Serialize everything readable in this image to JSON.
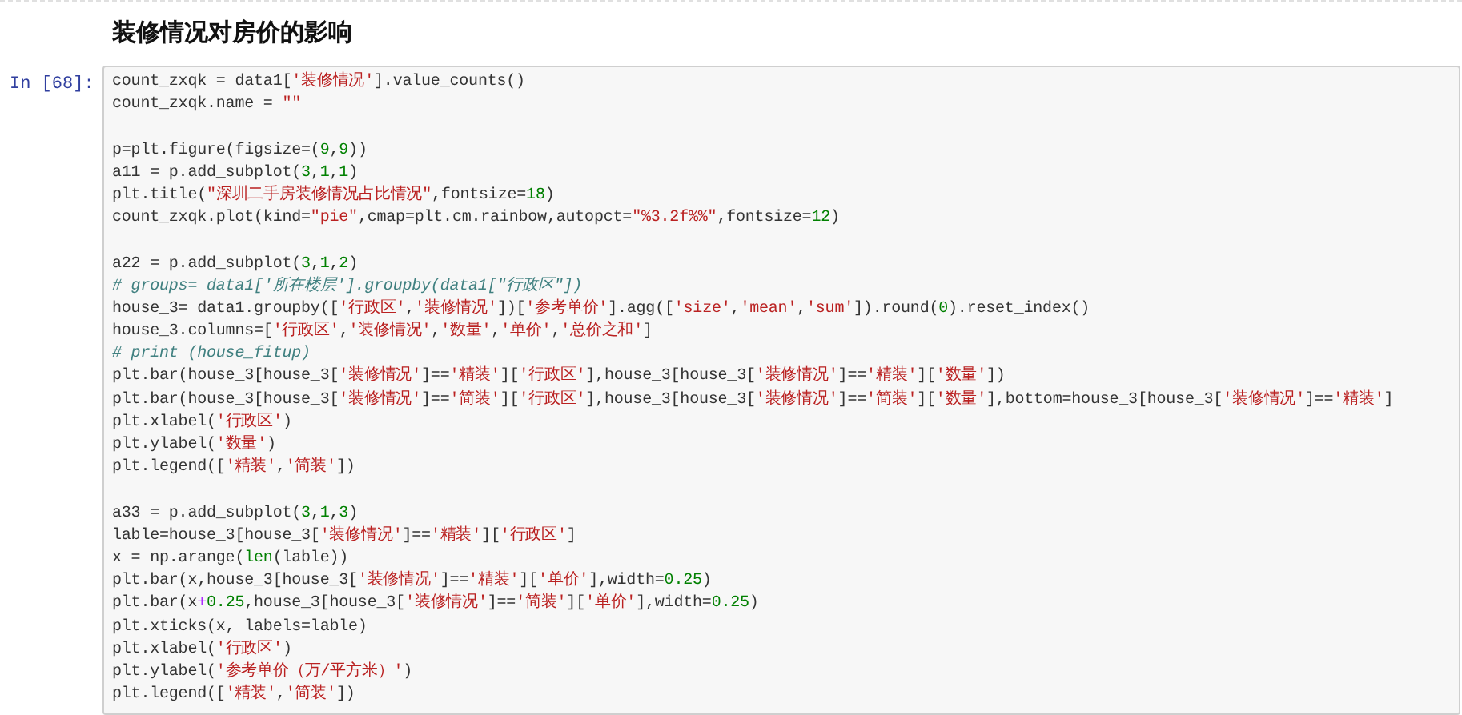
{
  "heading": "装修情况对房价的影响",
  "cell": {
    "prompt": "In [68]:",
    "blocks": [
      [
        [
          {
            "kind": "code",
            "text": "count_zxqk = data1["
          },
          {
            "kind": "string",
            "text": "'装修情况'"
          },
          {
            "kind": "code",
            "text": "].value_counts()"
          }
        ],
        [
          {
            "kind": "code",
            "text": "count_zxqk.name = "
          },
          {
            "kind": "string",
            "text": "\"\""
          }
        ]
      ],
      [
        [
          {
            "kind": "code",
            "text": "p=plt.figure(figsize=("
          },
          {
            "kind": "number",
            "text": "9"
          },
          {
            "kind": "code",
            "text": ","
          },
          {
            "kind": "number",
            "text": "9"
          },
          {
            "kind": "code",
            "text": "))"
          }
        ],
        [
          {
            "kind": "code",
            "text": "a11 = p.add_subplot("
          },
          {
            "kind": "number",
            "text": "3"
          },
          {
            "kind": "code",
            "text": ","
          },
          {
            "kind": "number",
            "text": "1"
          },
          {
            "kind": "code",
            "text": ","
          },
          {
            "kind": "number",
            "text": "1"
          },
          {
            "kind": "code",
            "text": ")"
          }
        ],
        [
          {
            "kind": "code",
            "text": "plt.title("
          },
          {
            "kind": "string",
            "text": "\"深圳二手房装修情况占比情况\""
          },
          {
            "kind": "code",
            "text": ",fontsize="
          },
          {
            "kind": "number",
            "text": "18"
          },
          {
            "kind": "code",
            "text": ")"
          }
        ],
        [
          {
            "kind": "code",
            "text": "count_zxqk.plot(kind="
          },
          {
            "kind": "string",
            "text": "\"pie\""
          },
          {
            "kind": "code",
            "text": ",cmap=plt.cm.rainbow,autopct="
          },
          {
            "kind": "string",
            "text": "\"%3.2f%%\""
          },
          {
            "kind": "code",
            "text": ",fontsize="
          },
          {
            "kind": "number",
            "text": "12"
          },
          {
            "kind": "code",
            "text": ")"
          }
        ]
      ],
      [
        [
          {
            "kind": "code",
            "text": "a22 = p.add_subplot("
          },
          {
            "kind": "number",
            "text": "3"
          },
          {
            "kind": "code",
            "text": ","
          },
          {
            "kind": "number",
            "text": "1"
          },
          {
            "kind": "code",
            "text": ","
          },
          {
            "kind": "number",
            "text": "2"
          },
          {
            "kind": "code",
            "text": ")"
          }
        ],
        [
          {
            "kind": "comment",
            "text": "# groups= data1['所在楼层'].groupby(data1[\"行政区\"])"
          }
        ],
        [
          {
            "kind": "code",
            "text": "house_3= data1.groupby(["
          },
          {
            "kind": "string",
            "text": "'行政区'"
          },
          {
            "kind": "code",
            "text": ","
          },
          {
            "kind": "string",
            "text": "'装修情况'"
          },
          {
            "kind": "code",
            "text": "])["
          },
          {
            "kind": "string",
            "text": "'参考单价'"
          },
          {
            "kind": "code",
            "text": "].agg(["
          },
          {
            "kind": "string",
            "text": "'size'"
          },
          {
            "kind": "code",
            "text": ","
          },
          {
            "kind": "string",
            "text": "'mean'"
          },
          {
            "kind": "code",
            "text": ","
          },
          {
            "kind": "string",
            "text": "'sum'"
          },
          {
            "kind": "code",
            "text": "]).round("
          },
          {
            "kind": "number",
            "text": "0"
          },
          {
            "kind": "code",
            "text": ").reset_index()"
          }
        ],
        [
          {
            "kind": "code",
            "text": "house_3.columns=["
          },
          {
            "kind": "string",
            "text": "'行政区'"
          },
          {
            "kind": "code",
            "text": ","
          },
          {
            "kind": "string",
            "text": "'装修情况'"
          },
          {
            "kind": "code",
            "text": ","
          },
          {
            "kind": "string",
            "text": "'数量'"
          },
          {
            "kind": "code",
            "text": ","
          },
          {
            "kind": "string",
            "text": "'单价'"
          },
          {
            "kind": "code",
            "text": ","
          },
          {
            "kind": "string",
            "text": "'总价之和'"
          },
          {
            "kind": "code",
            "text": "]"
          }
        ],
        [
          {
            "kind": "comment",
            "text": "# print (house_fitup)"
          }
        ],
        [
          {
            "kind": "code",
            "text": "plt.bar(house_3[house_3["
          },
          {
            "kind": "string",
            "text": "'装修情况'"
          },
          {
            "kind": "code",
            "text": "]=="
          },
          {
            "kind": "string",
            "text": "'精装'"
          },
          {
            "kind": "code",
            "text": "]["
          },
          {
            "kind": "string",
            "text": "'行政区'"
          },
          {
            "kind": "code",
            "text": "],house_3[house_3["
          },
          {
            "kind": "string",
            "text": "'装修情况'"
          },
          {
            "kind": "code",
            "text": "]=="
          },
          {
            "kind": "string",
            "text": "'精装'"
          },
          {
            "kind": "code",
            "text": "]["
          },
          {
            "kind": "string",
            "text": "'数量'"
          },
          {
            "kind": "code",
            "text": "])"
          }
        ],
        [
          {
            "kind": "code",
            "text": "plt.bar(house_3[house_3["
          },
          {
            "kind": "string",
            "text": "'装修情况'"
          },
          {
            "kind": "code",
            "text": "]=="
          },
          {
            "kind": "string",
            "text": "'简装'"
          },
          {
            "kind": "code",
            "text": "]["
          },
          {
            "kind": "string",
            "text": "'行政区'"
          },
          {
            "kind": "code",
            "text": "],house_3[house_3["
          },
          {
            "kind": "string",
            "text": "'装修情况'"
          },
          {
            "kind": "code",
            "text": "]=="
          },
          {
            "kind": "string",
            "text": "'简装'"
          },
          {
            "kind": "code",
            "text": "]["
          },
          {
            "kind": "string",
            "text": "'数量'"
          },
          {
            "kind": "code",
            "text": "],bottom=house_3[house_3["
          },
          {
            "kind": "string",
            "text": "'装修情况'"
          },
          {
            "kind": "code",
            "text": "]=="
          },
          {
            "kind": "string",
            "text": "'精装'"
          },
          {
            "kind": "code",
            "text": "]"
          }
        ],
        [
          {
            "kind": "code",
            "text": "plt.xlabel("
          },
          {
            "kind": "string",
            "text": "'行政区'"
          },
          {
            "kind": "code",
            "text": ")"
          }
        ],
        [
          {
            "kind": "code",
            "text": "plt.ylabel("
          },
          {
            "kind": "string",
            "text": "'数量'"
          },
          {
            "kind": "code",
            "text": ")"
          }
        ],
        [
          {
            "kind": "code",
            "text": "plt.legend(["
          },
          {
            "kind": "string",
            "text": "'精装'"
          },
          {
            "kind": "code",
            "text": ","
          },
          {
            "kind": "string",
            "text": "'简装'"
          },
          {
            "kind": "code",
            "text": "])"
          }
        ]
      ],
      [
        [
          {
            "kind": "code",
            "text": "a33 = p.add_subplot("
          },
          {
            "kind": "number",
            "text": "3"
          },
          {
            "kind": "code",
            "text": ","
          },
          {
            "kind": "number",
            "text": "1"
          },
          {
            "kind": "code",
            "text": ","
          },
          {
            "kind": "number",
            "text": "3"
          },
          {
            "kind": "code",
            "text": ")"
          }
        ],
        [
          {
            "kind": "code",
            "text": "lable=house_3[house_3["
          },
          {
            "kind": "string",
            "text": "'装修情况'"
          },
          {
            "kind": "code",
            "text": "]=="
          },
          {
            "kind": "string",
            "text": "'精装'"
          },
          {
            "kind": "code",
            "text": "]["
          },
          {
            "kind": "string",
            "text": "'行政区'"
          },
          {
            "kind": "code",
            "text": "]"
          }
        ],
        [
          {
            "kind": "code",
            "text": "x = np.arange("
          },
          {
            "kind": "builtin",
            "text": "len"
          },
          {
            "kind": "code",
            "text": "(lable))"
          }
        ],
        [
          {
            "kind": "code",
            "text": "plt.bar(x,house_3[house_3["
          },
          {
            "kind": "string",
            "text": "'装修情况'"
          },
          {
            "kind": "code",
            "text": "]=="
          },
          {
            "kind": "string",
            "text": "'精装'"
          },
          {
            "kind": "code",
            "text": "]["
          },
          {
            "kind": "string",
            "text": "'单价'"
          },
          {
            "kind": "code",
            "text": "],width="
          },
          {
            "kind": "number",
            "text": "0.25"
          },
          {
            "kind": "code",
            "text": ")"
          }
        ],
        [
          {
            "kind": "code",
            "text": "plt.bar(x"
          },
          {
            "kind": "operator",
            "text": "+"
          },
          {
            "kind": "number",
            "text": "0.25"
          },
          {
            "kind": "code",
            "text": ",house_3[house_3["
          },
          {
            "kind": "string",
            "text": "'装修情况'"
          },
          {
            "kind": "code",
            "text": "]=="
          },
          {
            "kind": "string",
            "text": "'简装'"
          },
          {
            "kind": "code",
            "text": "]["
          },
          {
            "kind": "string",
            "text": "'单价'"
          },
          {
            "kind": "code",
            "text": "],width="
          },
          {
            "kind": "number",
            "text": "0.25"
          },
          {
            "kind": "code",
            "text": ")"
          }
        ],
        [
          {
            "kind": "code",
            "text": "plt.xticks(x, labels=lable)"
          }
        ],
        [
          {
            "kind": "code",
            "text": "plt.xlabel("
          },
          {
            "kind": "string",
            "text": "'行政区'"
          },
          {
            "kind": "code",
            "text": ")"
          }
        ],
        [
          {
            "kind": "code",
            "text": "plt.ylabel("
          },
          {
            "kind": "string",
            "text": "'参考单价（万/平方米）'"
          },
          {
            "kind": "code",
            "text": ")"
          }
        ],
        [
          {
            "kind": "code",
            "text": "plt.legend(["
          },
          {
            "kind": "string",
            "text": "'精装'"
          },
          {
            "kind": "code",
            "text": ","
          },
          {
            "kind": "string",
            "text": "'简装'"
          },
          {
            "kind": "code",
            "text": "])"
          }
        ]
      ]
    ]
  }
}
